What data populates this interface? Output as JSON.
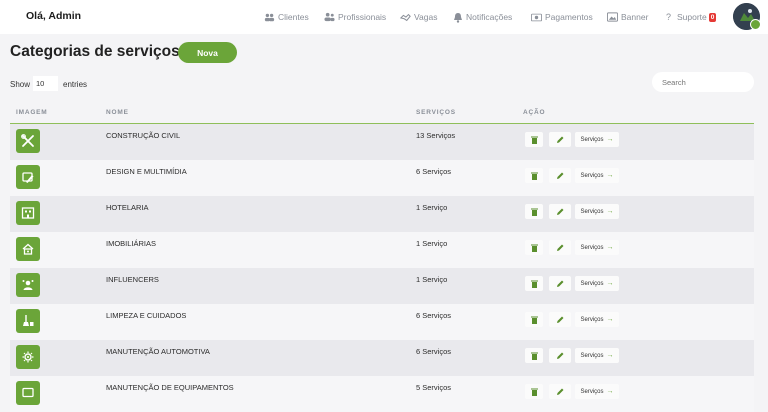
{
  "header": {
    "greeting": "Olá, Admin",
    "nav": [
      {
        "label": "Clientes",
        "icon": "users-icon"
      },
      {
        "label": "Profissionais",
        "icon": "professionals-icon"
      },
      {
        "label": "Vagas",
        "icon": "handshake-icon"
      },
      {
        "label": "Notificações",
        "icon": "bell-icon"
      },
      {
        "label": "Pagamentos",
        "icon": "money-icon"
      },
      {
        "label": "Banner",
        "icon": "image-icon"
      },
      {
        "label": "Suporte",
        "icon": "question-icon",
        "badge": "0"
      }
    ],
    "avatar": "user-avatar"
  },
  "page": {
    "title": "Categorias de serviços",
    "new_button": "Nova"
  },
  "table_controls": {
    "show_label": "Show",
    "entries_value": "10",
    "entries_label": "entries",
    "search_placeholder": "Search"
  },
  "table": {
    "columns": [
      "IMAGEM",
      "NOME",
      "SERVIÇOS",
      "AÇÃO"
    ],
    "action_label": "Serviços",
    "rows": [
      {
        "name": "CONSTRUÇÃO CIVIL",
        "count": "13 Serviços",
        "icon": "tools-icon"
      },
      {
        "name": "DESIGN E MULTIMÍDIA",
        "count": "6 Serviços",
        "icon": "design-icon"
      },
      {
        "name": "HOTELARIA",
        "count": "1 Serviço",
        "icon": "hotel-icon"
      },
      {
        "name": "IMOBILIÁRIAS",
        "count": "1 Serviço",
        "icon": "real-estate-icon"
      },
      {
        "name": "INFLUENCERS",
        "count": "1 Serviço",
        "icon": "influencer-icon"
      },
      {
        "name": "LIMPEZA E CUIDADOS",
        "count": "6 Serviços",
        "icon": "cleaning-icon"
      },
      {
        "name": "MANUTENÇÃO AUTOMOTIVA",
        "count": "6 Serviços",
        "icon": "car-gear-icon"
      },
      {
        "name": "MANUTENÇÃO DE EQUIPAMENTOS",
        "count": "5 Serviços",
        "icon": "equipment-icon"
      }
    ]
  },
  "colors": {
    "accent": "#6ba539",
    "badge": "#e53935"
  }
}
